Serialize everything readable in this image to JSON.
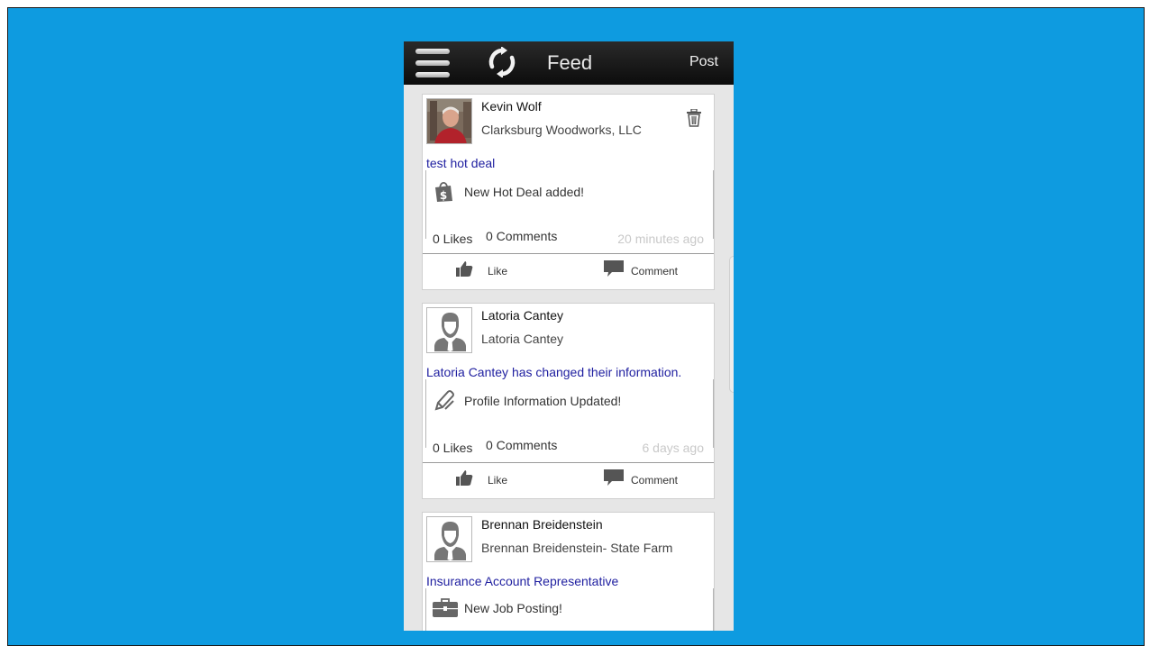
{
  "app": {
    "title": "Feed",
    "post_label": "Post"
  },
  "feed": {
    "items": [
      {
        "name": "Kevin Wolf",
        "company": "Clarksburg Woodworks, LLC",
        "title": "test hot deal",
        "activity": "New Hot Deal added!",
        "activity_icon": "shopping-bag-icon",
        "likes": "0 Likes",
        "comments": "0 Comments",
        "time": "20 minutes ago",
        "like_label": "Like",
        "comment_label": "Comment"
      },
      {
        "name": "Latoria Cantey",
        "company": "Latoria Cantey",
        "title": "Latoria Cantey has changed their information.",
        "activity": "Profile Information Updated!",
        "activity_icon": "pencil-icon",
        "likes": "0 Likes",
        "comments": "0 Comments",
        "time": "6 days ago",
        "like_label": "Like",
        "comment_label": "Comment"
      },
      {
        "name": "Brennan Breidenstein",
        "company": "Brennan Breidenstein- State Farm",
        "title": "Insurance Account Representative",
        "activity": "New Job Posting!",
        "activity_icon": "briefcase-icon"
      }
    ]
  },
  "colors": {
    "background": "#0e9be0",
    "appbar": "#111111",
    "link": "#1f1fa0",
    "timestamp": "#c9c9c9"
  }
}
